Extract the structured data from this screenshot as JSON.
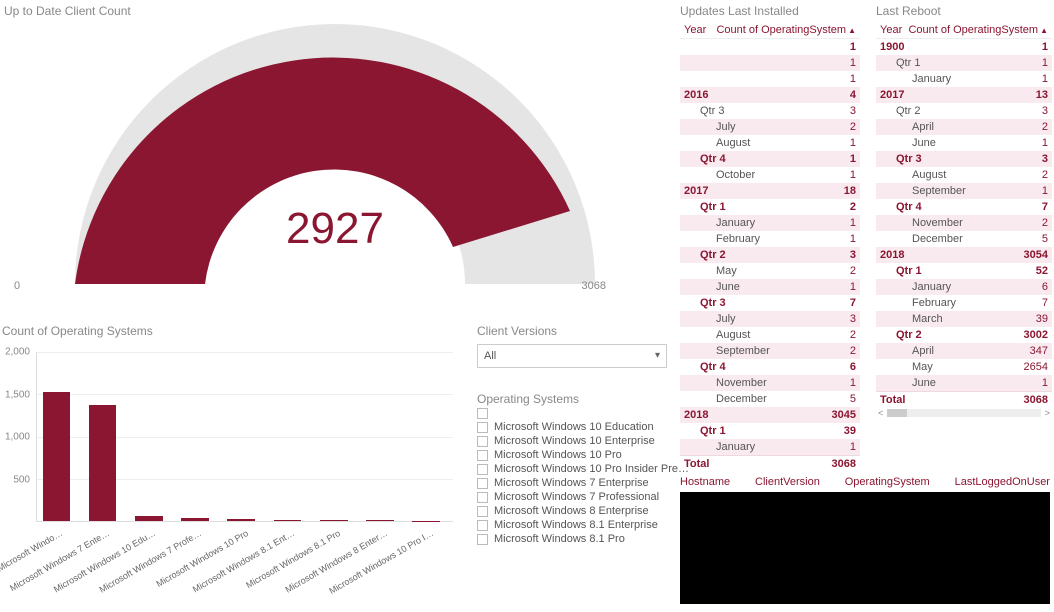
{
  "titles": {
    "gauge": "Up to Date Client Count",
    "bars": "Count of Operating Systems",
    "clientVersions": "Client Versions",
    "operatingSystems": "Operating Systems",
    "updates": "Updates Last Installed",
    "reboot": "Last Reboot"
  },
  "gauge": {
    "value": "2927",
    "min": "0",
    "max": "3068"
  },
  "clientVersions": {
    "selected": "All"
  },
  "osOptions": [
    "Microsoft Windows 10 Education",
    "Microsoft Windows 10 Enterprise",
    "Microsoft Windows 10 Pro",
    "Microsoft Windows 10 Pro Insider Pre…",
    "Microsoft Windows 7 Enterprise",
    "Microsoft Windows 7 Professional",
    "Microsoft Windows 8 Enterprise",
    "Microsoft Windows 8.1 Enterprise",
    "Microsoft Windows 8.1 Pro"
  ],
  "barYTicks": [
    "2,000",
    "1,500",
    "1,000",
    "500"
  ],
  "tableHeaders": {
    "year": "Year",
    "count": "Count of OperatingSystem",
    "hostname": "Hostname",
    "clientVersion": "ClientVersion",
    "operatingSystem": "OperatingSystem",
    "lastLogged": "LastLoggedOnUser",
    "total": "Total"
  },
  "totals": {
    "updates": "3068",
    "reboot": "3068"
  },
  "chart_data": [
    {
      "type": "gauge",
      "title": "Up to Date Client Count",
      "value": 2927,
      "min": 0,
      "max": 3068
    },
    {
      "type": "bar",
      "title": "Count of Operating Systems",
      "ylabel": "",
      "ylim": [
        0,
        2000
      ],
      "categories": [
        "Microsoft Windo…",
        "Microsoft Windows 7 Ente…",
        "Microsoft Windows 10 Edu…",
        "Microsoft Windows 7 Profe…",
        "Microsoft Windows 10 Pro",
        "Microsoft Windows 8.1 Ent…",
        "Microsoft Windows 8.1 Pro",
        "Microsoft Windows 8 Enter…",
        "Microsoft Windows 10 Pro I…"
      ],
      "values": [
        1530,
        1370,
        60,
        40,
        20,
        15,
        10,
        10,
        5
      ]
    },
    {
      "type": "table",
      "title": "Updates Last Installed",
      "columns": [
        "Year",
        "Count of OperatingSystem"
      ],
      "rows": [
        [
          "",
          1,
          0,
          true
        ],
        [
          "",
          1,
          0,
          false
        ],
        [
          "",
          1,
          0,
          false
        ],
        [
          "2016",
          4,
          0,
          true
        ],
        [
          "Qtr 3",
          3,
          1,
          false
        ],
        [
          "July",
          2,
          2,
          false
        ],
        [
          "August",
          1,
          2,
          false
        ],
        [
          "Qtr 4",
          1,
          1,
          true
        ],
        [
          "October",
          1,
          2,
          false
        ],
        [
          "2017",
          18,
          0,
          true
        ],
        [
          "Qtr 1",
          2,
          1,
          true
        ],
        [
          "January",
          1,
          2,
          false
        ],
        [
          "February",
          1,
          2,
          false
        ],
        [
          "Qtr 2",
          3,
          1,
          true
        ],
        [
          "May",
          2,
          2,
          false
        ],
        [
          "June",
          1,
          2,
          false
        ],
        [
          "Qtr 3",
          7,
          1,
          true
        ],
        [
          "July",
          3,
          2,
          false
        ],
        [
          "August",
          2,
          2,
          false
        ],
        [
          "September",
          2,
          2,
          false
        ],
        [
          "Qtr 4",
          6,
          1,
          true
        ],
        [
          "November",
          1,
          2,
          false
        ],
        [
          "December",
          5,
          2,
          false
        ],
        [
          "2018",
          3045,
          0,
          true
        ],
        [
          "Qtr 1",
          39,
          1,
          true
        ],
        [
          "January",
          1,
          2,
          false
        ]
      ],
      "total": 3068
    },
    {
      "type": "table",
      "title": "Last Reboot",
      "columns": [
        "Year",
        "Count of OperatingSystem"
      ],
      "rows": [
        [
          "1900",
          1,
          0,
          true
        ],
        [
          "Qtr 1",
          1,
          1,
          false
        ],
        [
          "January",
          1,
          2,
          false
        ],
        [
          "2017",
          13,
          0,
          true
        ],
        [
          "Qtr 2",
          3,
          1,
          false
        ],
        [
          "April",
          2,
          2,
          false
        ],
        [
          "June",
          1,
          2,
          false
        ],
        [
          "Qtr 3",
          3,
          1,
          true
        ],
        [
          "August",
          2,
          2,
          false
        ],
        [
          "September",
          1,
          2,
          false
        ],
        [
          "Qtr 4",
          7,
          1,
          true
        ],
        [
          "November",
          2,
          2,
          false
        ],
        [
          "December",
          5,
          2,
          false
        ],
        [
          "2018",
          3054,
          0,
          true
        ],
        [
          "Qtr 1",
          52,
          1,
          true
        ],
        [
          "January",
          6,
          2,
          false
        ],
        [
          "February",
          7,
          2,
          false
        ],
        [
          "March",
          39,
          2,
          false
        ],
        [
          "Qtr 2",
          3002,
          1,
          true
        ],
        [
          "April",
          347,
          2,
          false
        ],
        [
          "May",
          2654,
          2,
          false
        ],
        [
          "June",
          1,
          2,
          false
        ]
      ],
      "total": 3068
    }
  ]
}
